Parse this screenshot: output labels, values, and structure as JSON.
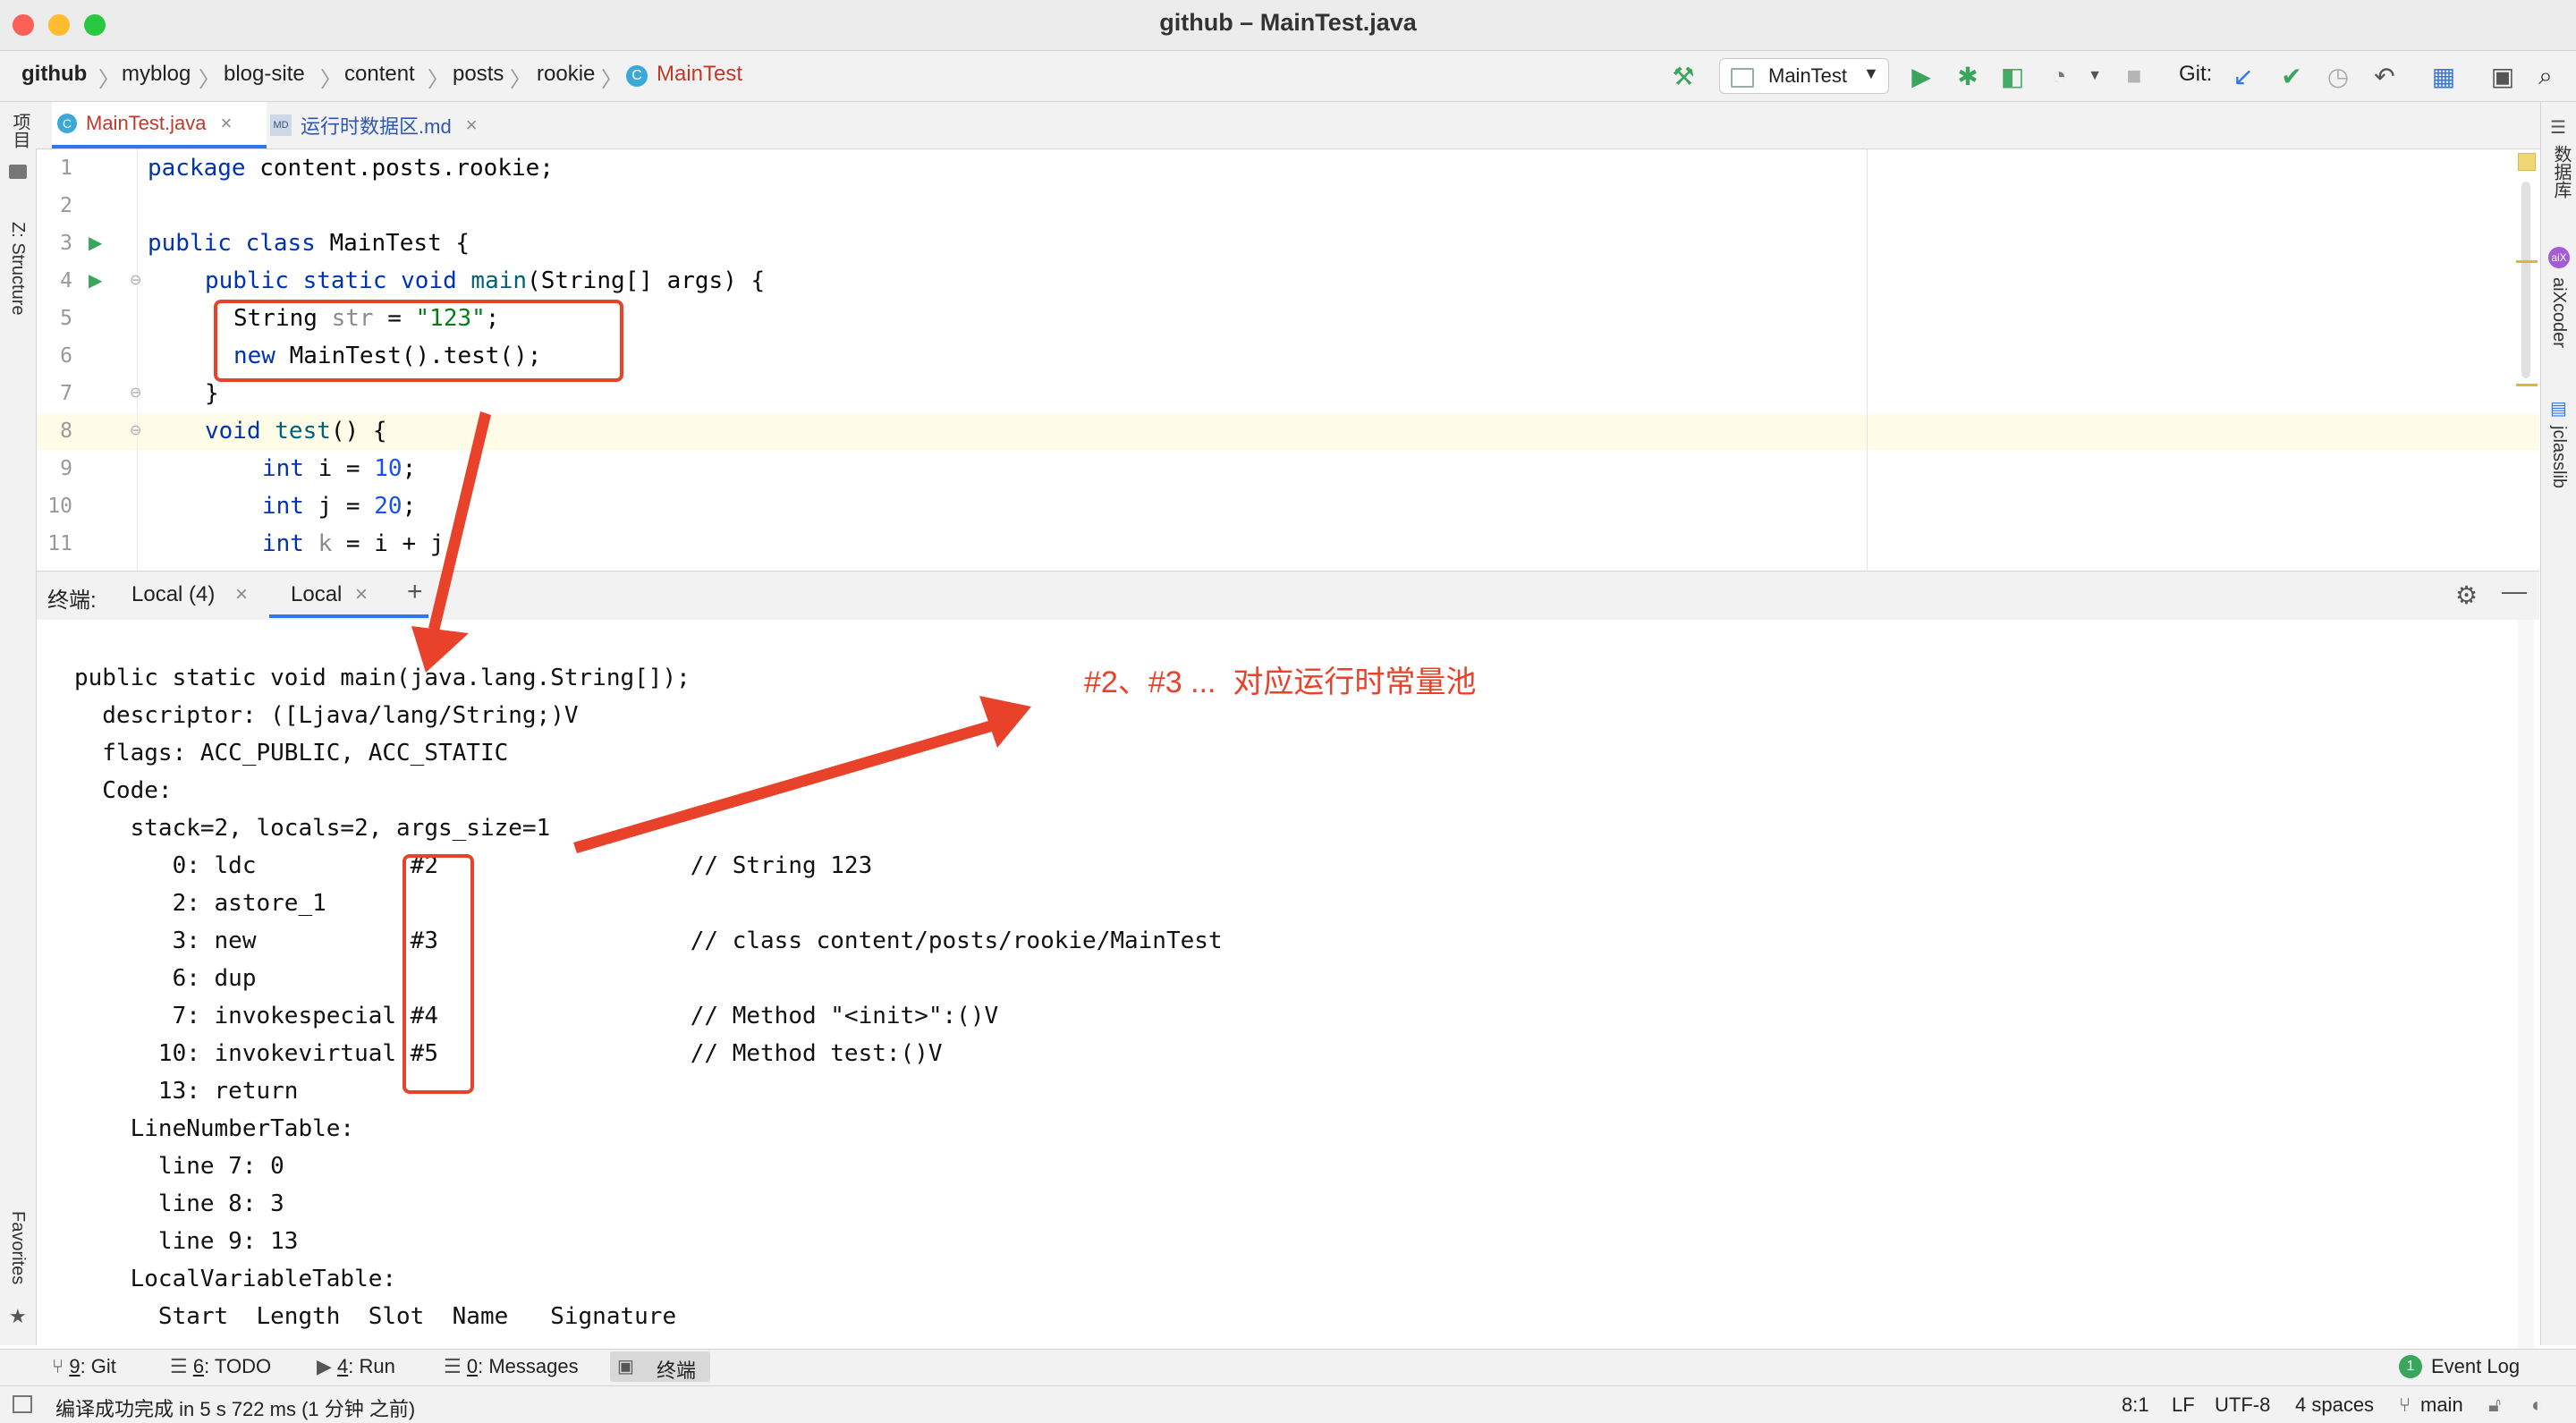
{
  "window": {
    "title": "github – MainTest.java"
  },
  "breadcrumbs": [
    "github",
    "myblog",
    "blog-site",
    "content",
    "posts",
    "rookie",
    "MainTest"
  ],
  "run_config": "MainTest",
  "git_label": "Git:",
  "file_tabs": [
    {
      "label": "MainTest.java",
      "icon": "java-class-icon",
      "active": true
    },
    {
      "label": "运行时数据区.md",
      "icon": "markdown-icon",
      "active": false
    }
  ],
  "left_strip": {
    "project": "项目",
    "structure": "Z: Structure",
    "favorites": "Favorites"
  },
  "right_strip": {
    "database": "数据库",
    "aixcoder": "aiXcoder",
    "jclasslib": "jclasslib"
  },
  "editor": {
    "line_numbers": [
      "1",
      "2",
      "3",
      "4",
      "5",
      "6",
      "7",
      "8",
      "9",
      "10",
      "11"
    ],
    "lines": {
      "l1_kw": "package",
      "l1_rest": " content.posts.rookie;",
      "l3_kw": "public class",
      "l3_rest": " MainTest {",
      "l4_kw": "public static void",
      "l4_m": "main",
      "l4_rest": "(String[] args) {",
      "l5_type": "String ",
      "l5_var": "str",
      "l5_eq": " = ",
      "l5_str": "\"123\"",
      "l5_end": ";",
      "l6_kw": "new",
      "l6_rest": " MainTest().test();",
      "l7": "}",
      "l8_kw": "void",
      "l8_m": "test",
      "l8_rest": "() {",
      "l9_kw": "int",
      "l9_rest": " i = ",
      "l9_num": "10",
      "l9_end": ";",
      "l10_kw": "int",
      "l10_rest": " j = ",
      "l10_num": "20",
      "l10_end": ";",
      "l11_kw": "int",
      "l11_var": " k",
      "l11_rest": " = i + j"
    }
  },
  "terminal": {
    "label": "终端:",
    "tabs": [
      {
        "label": "Local (4)",
        "active": false
      },
      {
        "label": "Local",
        "active": true
      }
    ],
    "add": "+",
    "output": [
      "public static void main(java.lang.String[]);",
      "  descriptor: ([Ljava/lang/String;)V",
      "  flags: ACC_PUBLIC, ACC_STATIC",
      "  Code:",
      "    stack=2, locals=2, args_size=1",
      "       0: ldc           #2                  // String 123",
      "       2: astore_1",
      "       3: new           #3                  // class content/posts/rookie/MainTest",
      "       6: dup",
      "       7: invokespecial #4                  // Method \"<init>\":()V",
      "      10: invokevirtual #5                  // Method test:()V",
      "      13: return",
      "    LineNumberTable:",
      "      line 7: 0",
      "      line 8: 3",
      "      line 9: 13",
      "    LocalVariableTable:",
      "      Start  Length  Slot  Name   Signature"
    ]
  },
  "annotation": "#2、#3 ...  对应运行时常量池",
  "bottom_tools": [
    {
      "num": "9",
      "label": ": Git"
    },
    {
      "num": "6",
      "label": ": TODO"
    },
    {
      "num": "4",
      "label": ": Run"
    },
    {
      "num": "0",
      "label": ": Messages"
    },
    {
      "num": "",
      "label": "终端"
    }
  ],
  "event_log": {
    "badge": "1",
    "label": "Event Log"
  },
  "status": {
    "message": "编译成功完成 in 5 s 722 ms (1 分钟 之前)",
    "position": "8:1",
    "line_sep": "LF",
    "encoding": "UTF-8",
    "indent": "4 spaces",
    "branch": "main"
  },
  "colors": {
    "annotation_red": "#e8432a",
    "run_green": "#3aa55d",
    "accent_blue": "#3574f0"
  }
}
